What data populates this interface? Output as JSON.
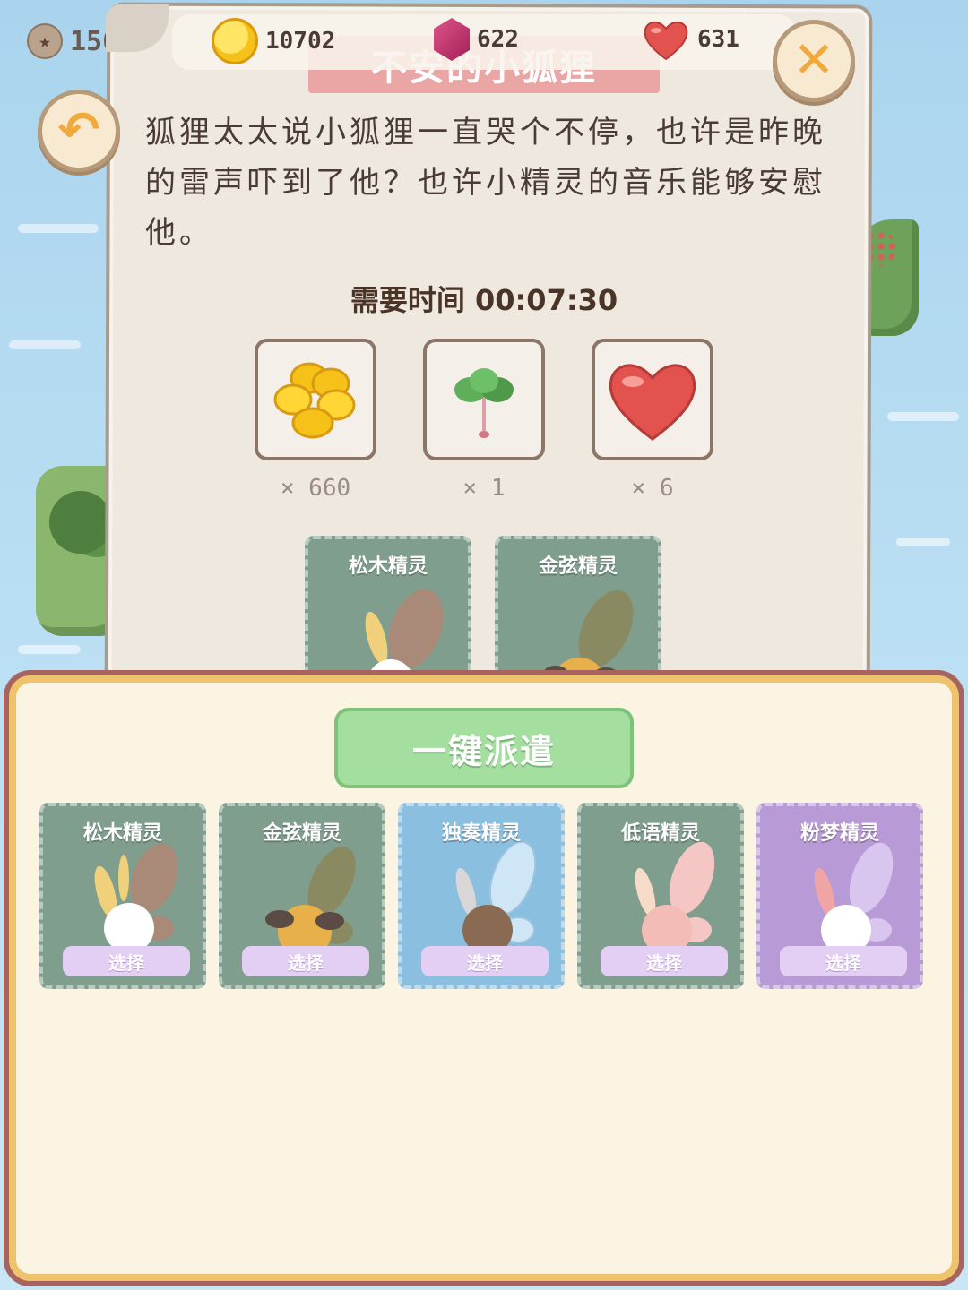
{
  "hud": {
    "level": "156",
    "coins": "10702",
    "gems": "622",
    "hearts": "631"
  },
  "quest": {
    "title": "不安的小狐狸",
    "description": "狐狸太太说小狐狸一直哭个不停，也许是昨晚的雷声吓到了他？也许小精灵的音乐能够安慰他。",
    "time_label": "需要时间 00:07:30",
    "rewards": [
      {
        "icon": "coins-icon",
        "qty": "× 660"
      },
      {
        "icon": "spinach-icon",
        "qty": "× 1"
      },
      {
        "icon": "heart-icon",
        "qty": "× 6"
      }
    ],
    "assigned": [
      {
        "name": "松木精灵"
      },
      {
        "name": "金弦精灵"
      }
    ]
  },
  "dispatch": {
    "one_click_label": "一键派遣",
    "sprites": [
      {
        "name": "松木精灵",
        "select": "选择",
        "color": "#7f9e8e"
      },
      {
        "name": "金弦精灵",
        "select": "选择",
        "color": "#7f9e8e"
      },
      {
        "name": "独奏精灵",
        "select": "选择",
        "color": "#8bbfe0"
      },
      {
        "name": "低语精灵",
        "select": "选择",
        "color": "#7f9e8e"
      },
      {
        "name": "粉梦精灵",
        "select": "选择",
        "color": "#b79ad6"
      }
    ]
  }
}
